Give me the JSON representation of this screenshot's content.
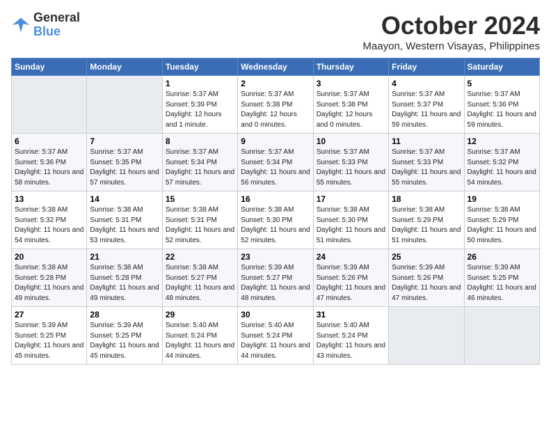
{
  "logo": {
    "line1": "General",
    "line2": "Blue"
  },
  "title": "October 2024",
  "location": "Maayon, Western Visayas, Philippines",
  "days_of_week": [
    "Sunday",
    "Monday",
    "Tuesday",
    "Wednesday",
    "Thursday",
    "Friday",
    "Saturday"
  ],
  "weeks": [
    [
      {
        "num": "",
        "detail": ""
      },
      {
        "num": "",
        "detail": ""
      },
      {
        "num": "1",
        "detail": "Sunrise: 5:37 AM\nSunset: 5:39 PM\nDaylight: 12 hours and 1 minute."
      },
      {
        "num": "2",
        "detail": "Sunrise: 5:37 AM\nSunset: 5:38 PM\nDaylight: 12 hours and 0 minutes."
      },
      {
        "num": "3",
        "detail": "Sunrise: 5:37 AM\nSunset: 5:38 PM\nDaylight: 12 hours and 0 minutes."
      },
      {
        "num": "4",
        "detail": "Sunrise: 5:37 AM\nSunset: 5:37 PM\nDaylight: 11 hours and 59 minutes."
      },
      {
        "num": "5",
        "detail": "Sunrise: 5:37 AM\nSunset: 5:36 PM\nDaylight: 11 hours and 59 minutes."
      }
    ],
    [
      {
        "num": "6",
        "detail": "Sunrise: 5:37 AM\nSunset: 5:36 PM\nDaylight: 11 hours and 58 minutes."
      },
      {
        "num": "7",
        "detail": "Sunrise: 5:37 AM\nSunset: 5:35 PM\nDaylight: 11 hours and 57 minutes."
      },
      {
        "num": "8",
        "detail": "Sunrise: 5:37 AM\nSunset: 5:34 PM\nDaylight: 11 hours and 57 minutes."
      },
      {
        "num": "9",
        "detail": "Sunrise: 5:37 AM\nSunset: 5:34 PM\nDaylight: 11 hours and 56 minutes."
      },
      {
        "num": "10",
        "detail": "Sunrise: 5:37 AM\nSunset: 5:33 PM\nDaylight: 11 hours and 55 minutes."
      },
      {
        "num": "11",
        "detail": "Sunrise: 5:37 AM\nSunset: 5:33 PM\nDaylight: 11 hours and 55 minutes."
      },
      {
        "num": "12",
        "detail": "Sunrise: 5:37 AM\nSunset: 5:32 PM\nDaylight: 11 hours and 54 minutes."
      }
    ],
    [
      {
        "num": "13",
        "detail": "Sunrise: 5:38 AM\nSunset: 5:32 PM\nDaylight: 11 hours and 54 minutes."
      },
      {
        "num": "14",
        "detail": "Sunrise: 5:38 AM\nSunset: 5:31 PM\nDaylight: 11 hours and 53 minutes."
      },
      {
        "num": "15",
        "detail": "Sunrise: 5:38 AM\nSunset: 5:31 PM\nDaylight: 11 hours and 52 minutes."
      },
      {
        "num": "16",
        "detail": "Sunrise: 5:38 AM\nSunset: 5:30 PM\nDaylight: 11 hours and 52 minutes."
      },
      {
        "num": "17",
        "detail": "Sunrise: 5:38 AM\nSunset: 5:30 PM\nDaylight: 11 hours and 51 minutes."
      },
      {
        "num": "18",
        "detail": "Sunrise: 5:38 AM\nSunset: 5:29 PM\nDaylight: 11 hours and 51 minutes."
      },
      {
        "num": "19",
        "detail": "Sunrise: 5:38 AM\nSunset: 5:29 PM\nDaylight: 11 hours and 50 minutes."
      }
    ],
    [
      {
        "num": "20",
        "detail": "Sunrise: 5:38 AM\nSunset: 5:28 PM\nDaylight: 11 hours and 49 minutes."
      },
      {
        "num": "21",
        "detail": "Sunrise: 5:38 AM\nSunset: 5:28 PM\nDaylight: 11 hours and 49 minutes."
      },
      {
        "num": "22",
        "detail": "Sunrise: 5:38 AM\nSunset: 5:27 PM\nDaylight: 11 hours and 48 minutes."
      },
      {
        "num": "23",
        "detail": "Sunrise: 5:39 AM\nSunset: 5:27 PM\nDaylight: 11 hours and 48 minutes."
      },
      {
        "num": "24",
        "detail": "Sunrise: 5:39 AM\nSunset: 5:26 PM\nDaylight: 11 hours and 47 minutes."
      },
      {
        "num": "25",
        "detail": "Sunrise: 5:39 AM\nSunset: 5:26 PM\nDaylight: 11 hours and 47 minutes."
      },
      {
        "num": "26",
        "detail": "Sunrise: 5:39 AM\nSunset: 5:25 PM\nDaylight: 11 hours and 46 minutes."
      }
    ],
    [
      {
        "num": "27",
        "detail": "Sunrise: 5:39 AM\nSunset: 5:25 PM\nDaylight: 11 hours and 45 minutes."
      },
      {
        "num": "28",
        "detail": "Sunrise: 5:39 AM\nSunset: 5:25 PM\nDaylight: 11 hours and 45 minutes."
      },
      {
        "num": "29",
        "detail": "Sunrise: 5:40 AM\nSunset: 5:24 PM\nDaylight: 11 hours and 44 minutes."
      },
      {
        "num": "30",
        "detail": "Sunrise: 5:40 AM\nSunset: 5:24 PM\nDaylight: 11 hours and 44 minutes."
      },
      {
        "num": "31",
        "detail": "Sunrise: 5:40 AM\nSunset: 5:24 PM\nDaylight: 11 hours and 43 minutes."
      },
      {
        "num": "",
        "detail": ""
      },
      {
        "num": "",
        "detail": ""
      }
    ]
  ]
}
